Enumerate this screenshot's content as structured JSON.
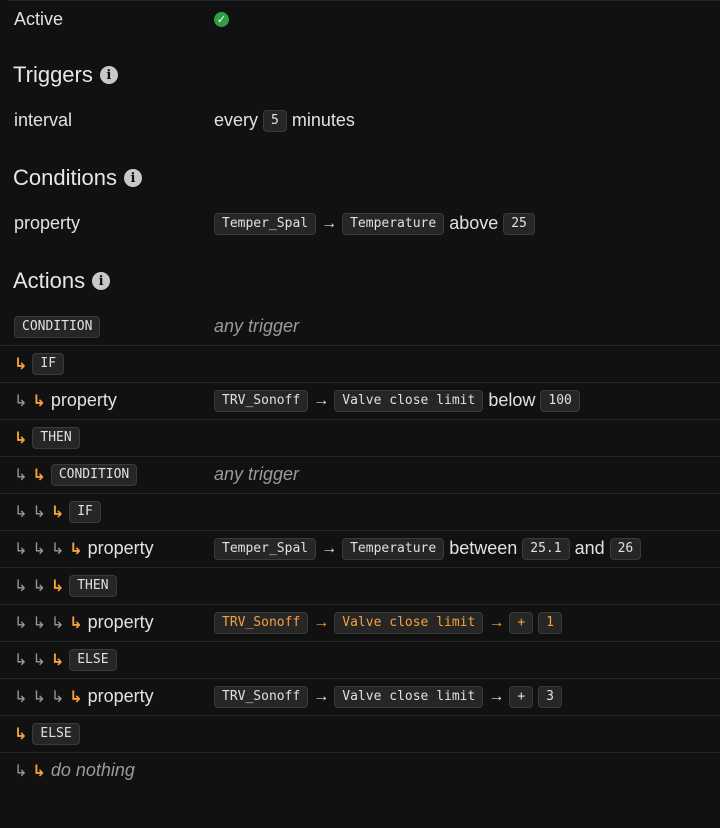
{
  "active": {
    "label": "Active",
    "status": "checked"
  },
  "triggers": {
    "heading": "Triggers",
    "row": {
      "label": "interval",
      "pre": "every",
      "value": "5",
      "post": "minutes"
    }
  },
  "conditions": {
    "heading": "Conditions",
    "row": {
      "label": "property",
      "device": "Temper_Spal",
      "property": "Temperature",
      "op": "above",
      "value": "25"
    }
  },
  "actions": {
    "heading": "Actions",
    "condition_label": "CONDITION",
    "any_trigger": "any trigger",
    "if_label": "IF",
    "then_label": "THEN",
    "else_label": "ELSE",
    "property_label": "property",
    "do_nothing": "do nothing",
    "if1": {
      "device": "TRV_Sonoff",
      "property": "Valve close limit",
      "op": "below",
      "value": "100"
    },
    "if2": {
      "device": "Temper_Spal",
      "property": "Temperature",
      "op": "between",
      "value1": "25.1",
      "and": "and",
      "value2": "26"
    },
    "then2": {
      "device": "TRV_Sonoff",
      "property": "Valve close limit",
      "op": "+",
      "value": "1"
    },
    "else2": {
      "device": "TRV_Sonoff",
      "property": "Valve close limit",
      "op": "+",
      "value": "3"
    }
  },
  "colors": {
    "accent": "#f5a13a",
    "background": "#111111",
    "chip": "#262626",
    "success": "#2ea043"
  },
  "icons": {
    "indent": "↳",
    "arrow": "→",
    "info": "info-icon",
    "check": "check-circle-icon"
  }
}
